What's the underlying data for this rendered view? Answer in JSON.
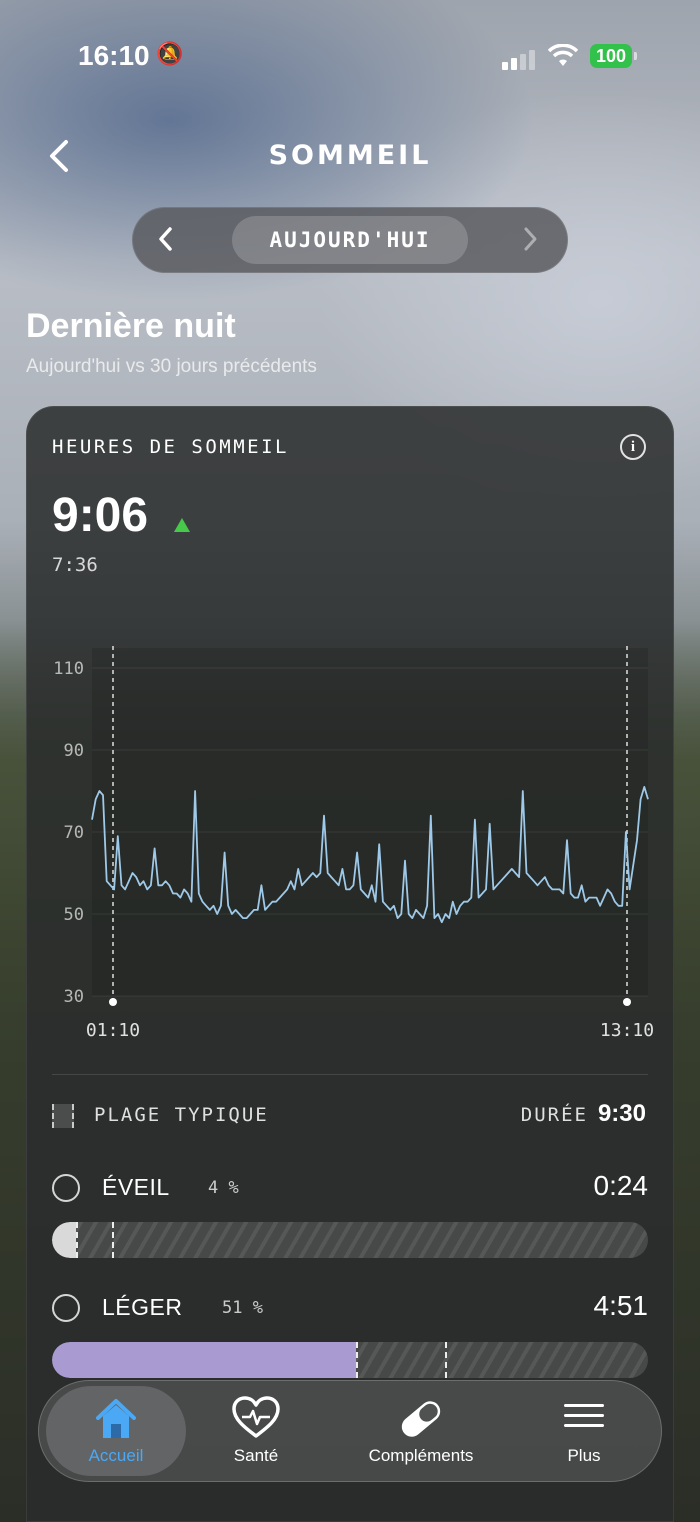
{
  "status_bar": {
    "time": "16:10",
    "battery": "100"
  },
  "header": {
    "title": "SOMMEIL"
  },
  "date_nav": {
    "label": "AUJOURD'HUI"
  },
  "section": {
    "title": "Dernière nuit",
    "subtitle": "Aujourd'hui vs 30 jours précédents"
  },
  "card": {
    "title": "HEURES DE SOMMEIL",
    "value": "9:06",
    "previous": "7:36",
    "typical_range_label": "PLAGE TYPIQUE",
    "duration_label": "DURÉE",
    "duration_value": "9:30"
  },
  "chart_data": {
    "type": "line",
    "y_ticks": [
      110,
      90,
      70,
      50,
      30
    ],
    "ylim": [
      30,
      110
    ],
    "x_labels": [
      "01:10",
      "13:10"
    ],
    "series": [
      {
        "color": "#9ec9e8",
        "values": [
          73,
          78,
          80,
          79,
          58,
          57,
          56,
          69,
          57,
          56,
          58,
          60,
          59,
          57,
          58,
          56,
          57,
          66,
          57,
          57,
          58,
          57,
          55,
          55,
          54,
          56,
          55,
          53,
          80,
          55,
          53,
          52,
          51,
          52,
          50,
          52,
          65,
          52,
          50,
          51,
          50,
          49,
          49,
          50,
          51,
          51,
          57,
          51,
          52,
          53,
          53,
          54,
          55,
          56,
          58,
          56,
          61,
          57,
          58,
          59,
          60,
          59,
          60,
          74,
          60,
          59,
          58,
          57,
          61,
          56,
          56,
          57,
          65,
          56,
          55,
          54,
          57,
          53,
          67,
          53,
          52,
          51,
          52,
          49,
          50,
          63,
          50,
          49,
          51,
          50,
          49,
          52,
          74,
          49,
          50,
          48,
          50,
          49,
          53,
          50,
          52,
          53,
          53,
          54,
          73,
          54,
          55,
          56,
          72,
          56,
          57,
          58,
          59,
          60,
          61,
          60,
          59,
          80,
          60,
          59,
          58,
          57,
          58,
          59,
          57,
          56,
          56,
          56,
          55,
          68,
          55,
          54,
          54,
          57,
          53,
          54,
          54,
          54,
          52,
          54,
          56,
          55,
          53,
          52,
          52,
          70,
          56,
          62,
          68,
          78,
          81,
          78
        ]
      }
    ]
  },
  "stages": [
    {
      "name": "ÉVEIL",
      "pct": "4 %",
      "value": "0:24",
      "fill": 0.04,
      "typical": 0.1,
      "color": "#d9d9d9"
    },
    {
      "name": "LÉGER",
      "pct": "51 %",
      "value": "4:51",
      "fill": 0.51,
      "typical": 0.66,
      "color": "#a99bd1",
      "typical_start": 0.51
    }
  ],
  "tabs": [
    {
      "label": "Accueil",
      "icon": "home-icon",
      "active": true
    },
    {
      "label": "Santé",
      "icon": "heart-pulse-icon"
    },
    {
      "label": "Compléments",
      "icon": "pill-icon"
    },
    {
      "label": "Plus",
      "icon": "menu-icon"
    }
  ],
  "colors": {
    "accent": "#4aa8f5",
    "trend_up": "#47c94a",
    "light_sleep": "#a99bd1"
  }
}
